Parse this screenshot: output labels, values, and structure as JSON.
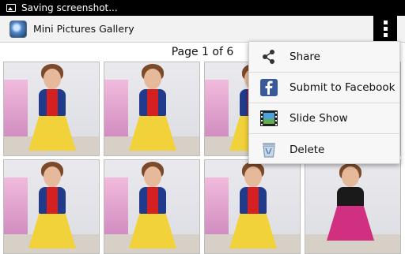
{
  "status": {
    "text": "Saving screenshot..."
  },
  "actionbar": {
    "title": "Mini Pictures Gallery"
  },
  "pager": {
    "text": "Page  1  of  6"
  },
  "menu": {
    "items": [
      {
        "label": "Share",
        "icon": "share-icon"
      },
      {
        "label": "Submit to Facebook",
        "icon": "facebook-icon"
      },
      {
        "label": "Slide Show",
        "icon": "film-icon"
      },
      {
        "label": "Delete",
        "icon": "trash-icon"
      }
    ]
  },
  "grid": {
    "thumbnails": [
      {
        "variant": "yellow"
      },
      {
        "variant": "yellow"
      },
      {
        "variant": "yellow"
      },
      {
        "variant": "yellow"
      },
      {
        "variant": "yellow"
      },
      {
        "variant": "yellow"
      },
      {
        "variant": "pink"
      }
    ]
  },
  "colors": {
    "statusbar": "#000000",
    "actionbar": "#f2f2f2",
    "menu": "#f7f7f7"
  }
}
